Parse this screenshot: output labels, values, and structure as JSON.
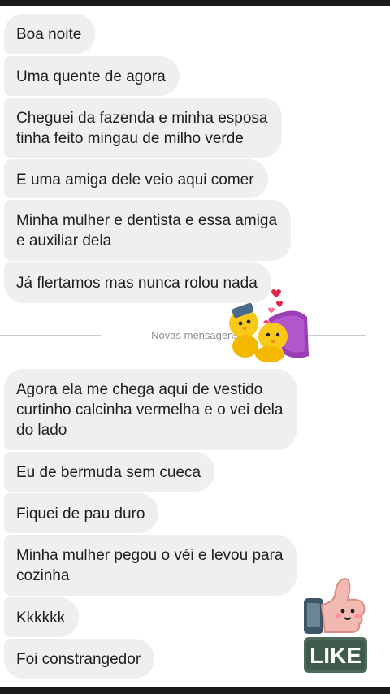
{
  "divider": {
    "label": "Novas mensagens"
  },
  "messages": [
    {
      "text": "Boa noite"
    },
    {
      "text": "Uma quente de agora"
    },
    {
      "line1": "Cheguei da fazenda e minha esposa",
      "line2": "tinha feito mingau de milho verde"
    },
    {
      "text": "E uma amiga dele veio aqui comer"
    },
    {
      "line1": "Minha mulher e dentista e essa amiga",
      "line2": "e auxiliar dela"
    },
    {
      "text": "Já flertamos mas nunca rolou nada"
    },
    {
      "line1": "Agora ela me chega aqui de vestido",
      "line2": "curtinho calcinha vermelha e o vei dela",
      "line3": "do lado"
    },
    {
      "text": "Eu de bermuda sem cueca"
    },
    {
      "text": "Fiquei de pau duro"
    },
    {
      "line1": "Minha mulher pegou o véi e levou para",
      "line2": "cozinha"
    },
    {
      "text": "Kkkkkk"
    },
    {
      "text": "Foi constrangedor"
    }
  ],
  "like_sticker": {
    "text": "LIKE",
    "icon": "thumbs-up-icon"
  },
  "couple_sticker": {
    "icon": "cuddling-chicks-sticker"
  },
  "colors": {
    "bubble": "#efefef",
    "text": "#1f1f1f",
    "divider": "#c9c9c9"
  }
}
